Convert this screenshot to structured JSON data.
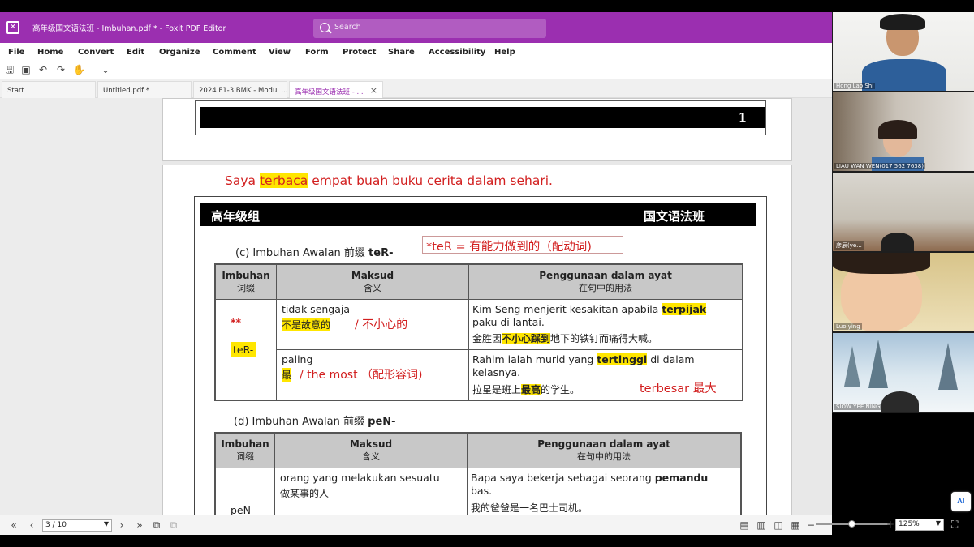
{
  "window": {
    "title": "高年级国文语法班 - Imbuhan.pdf * - Foxit PDF Editor",
    "search_placeholder": "Search"
  },
  "menu": [
    "File",
    "Home",
    "Convert",
    "Edit",
    "Organize",
    "Comment",
    "View",
    "Form",
    "Protect",
    "Share",
    "Accessibility",
    "Help"
  ],
  "toolbar_icons": [
    "save-icon",
    "new-file-icon",
    "undo-icon",
    "redo-icon",
    "hand-tool-icon",
    "dropdown-icon"
  ],
  "tabs": [
    {
      "label": "Start"
    },
    {
      "label": "Untitled.pdf *"
    },
    {
      "label": "2024 F1-3 BMK - Modul ..."
    },
    {
      "label": "高年级国文语法班 - ...",
      "active": true,
      "close": "×"
    }
  ],
  "page1": {
    "page_number": "1"
  },
  "page2": {
    "annot_top": {
      "pre": "Saya ",
      "highlight": "terbaca",
      "post": " empat buah buku cerita dalam sehari."
    },
    "header": {
      "left": "高年级组",
      "right": "国文语法班"
    },
    "section_c": {
      "label": "(c) Imbuhan Awalan 前缀 ",
      "bold": "teR-"
    },
    "annot_box": "*teR = 有能力做到的（配动词)",
    "table_headers": {
      "col1": "Imbuhan",
      "col1_sub": "词缀",
      "col2": "Maksud",
      "col2_sub": "含义",
      "col3": "Penggunaan dalam ayat",
      "col3_sub": "在句中的用法"
    },
    "ter": {
      "prefix": "teR-",
      "stars": "**",
      "row1": {
        "maksud": "tidak sengaja",
        "maksud_cn": "不是故意的",
        "annot": "/ 不小心的",
        "ayat_1": "Kim Seng menjerit kesakitan apabila",
        "ayat_hl": "terpijak",
        "ayat_2": "paku di lantai.",
        "cn_pre": "金胜因",
        "cn_hl": "不小心踩到",
        "cn_post": "地下的铁钉而痛得大喊。"
      },
      "row2": {
        "maksud": "paling",
        "maksud_cn": "最",
        "annot": "/ the most   （配形容词)",
        "ayat_1a": "Rahim ialah murid yang",
        "ayat_hl": "tertinggi",
        "ayat_1b": "di dalam",
        "ayat_2": "kelasnya.",
        "cn_pre": "拉星是班上",
        "cn_hl": "最高",
        "cn_post": "的学生。",
        "annot2": "terbesar 最大"
      }
    },
    "section_d": {
      "label": "(d) Imbuhan Awalan 前缀 ",
      "bold": "peN-"
    },
    "pen": {
      "prefix": "peN-",
      "maksud": "orang yang melakukan sesuatu",
      "maksud_cn": "做某事的人",
      "ayat_1": "Bapa saya bekerja sebagai seorang",
      "ayat_bold": "pemandu",
      "ayat_2": "bas.",
      "ayat_cn": "我的爸爸是一名巴士司机。"
    }
  },
  "statusbar": {
    "page_value": "3 / 10",
    "zoom_value": "125%"
  },
  "participants": [
    {
      "name": "Hong Lao Shi"
    },
    {
      "name": "LIAU WAN WEN(017 562 7638)"
    },
    {
      "name": "彦辰(ye..."
    },
    {
      "name": "Luo ying"
    },
    {
      "name": "SIOW YEE NING"
    }
  ],
  "colors": {
    "brand": "#9b2fb0",
    "annotation_red": "#d21f1f",
    "highlight": "#ffe600"
  }
}
